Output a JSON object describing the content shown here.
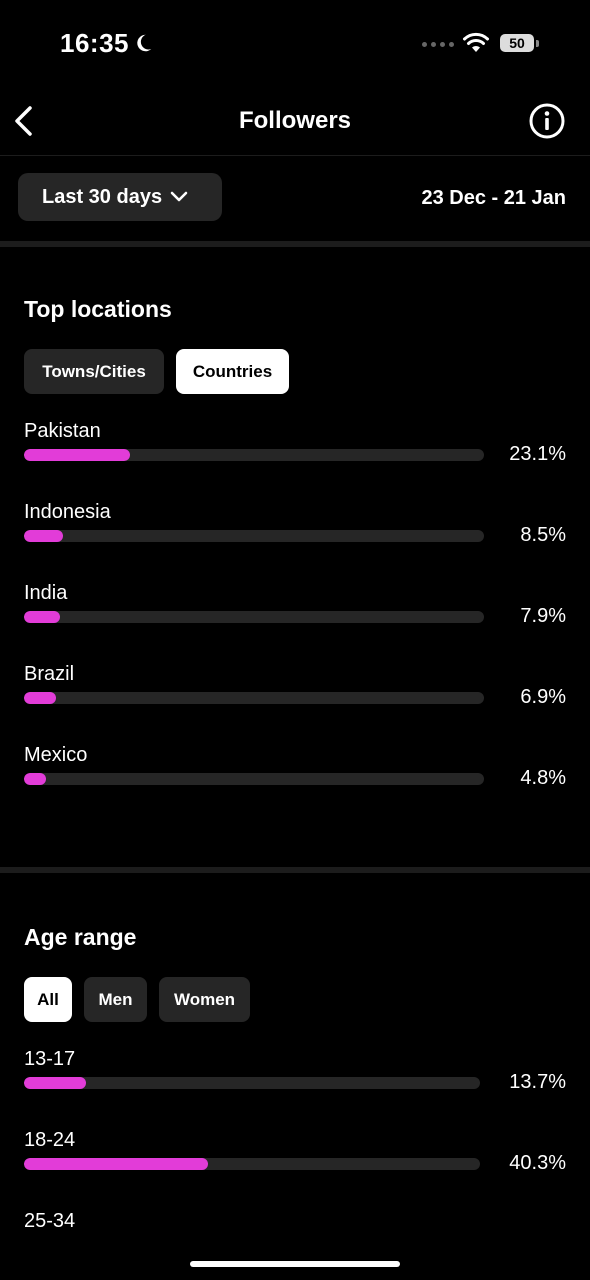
{
  "status_bar": {
    "time": "16:35",
    "battery": "50"
  },
  "header": {
    "title": "Followers"
  },
  "filter": {
    "range_label": "Last 30 days",
    "date_range": "23 Dec - 21 Jan"
  },
  "top_locations": {
    "title": "Top locations",
    "tabs": [
      {
        "label": "Towns/Cities",
        "selected": false
      },
      {
        "label": "Countries",
        "selected": true
      }
    ],
    "items": [
      {
        "label": "Pakistan",
        "percent_text": "23.1%",
        "value": 23.1
      },
      {
        "label": "Indonesia",
        "percent_text": "8.5%",
        "value": 8.5
      },
      {
        "label": "India",
        "percent_text": "7.9%",
        "value": 7.9
      },
      {
        "label": "Brazil",
        "percent_text": "6.9%",
        "value": 6.9
      },
      {
        "label": "Mexico",
        "percent_text": "4.8%",
        "value": 4.8
      }
    ]
  },
  "age_range": {
    "title": "Age range",
    "tabs": [
      {
        "label": "All",
        "selected": true
      },
      {
        "label": "Men",
        "selected": false
      },
      {
        "label": "Women",
        "selected": false
      }
    ],
    "items": [
      {
        "label": "13-17",
        "percent_text": "13.7%",
        "value": 13.7
      },
      {
        "label": "18-24",
        "percent_text": "40.3%",
        "value": 40.3
      },
      {
        "label": "25-34"
      }
    ]
  },
  "colors": {
    "bar_fill": "#e23cd8",
    "bar_track": "#262626",
    "background": "#000000"
  },
  "icons": [
    "moon-icon",
    "wifi-icon",
    "battery-icon",
    "back-chevron-icon",
    "info-icon",
    "chevron-down-icon"
  ]
}
